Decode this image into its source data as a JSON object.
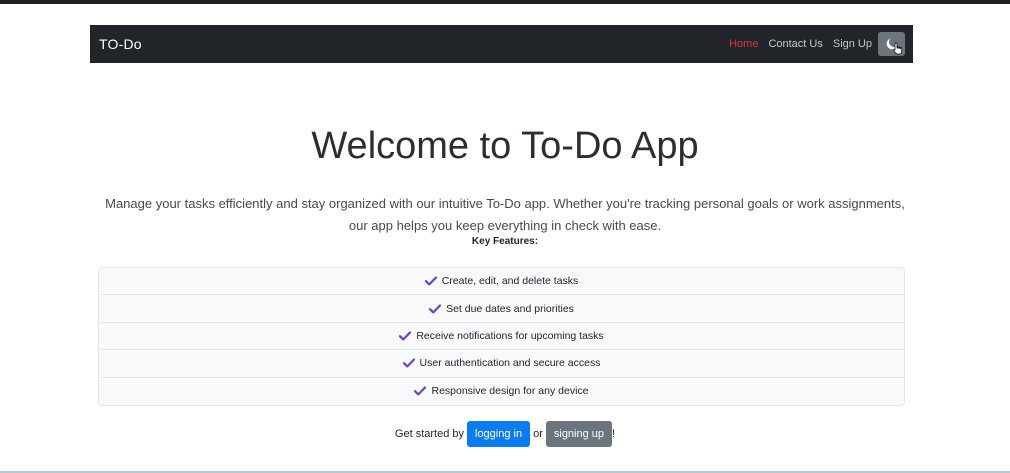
{
  "navbar": {
    "brand": "TO-Do",
    "links": [
      {
        "label": "Home",
        "active": true
      },
      {
        "label": "Contact Us",
        "active": false
      },
      {
        "label": "Sign Up",
        "active": false
      }
    ],
    "theme_toggle_icon": "moon-icon"
  },
  "hero": {
    "title": "Welcome to To-Do App",
    "lead": "Manage your tasks efficiently and stay organized with our intuitive To-Do app. Whether you're tracking personal goals or work assignments, our app helps you keep everything in check with ease."
  },
  "features": {
    "heading": "Key Features:",
    "icon": "check-icon",
    "items": [
      "Create, edit, and delete tasks",
      "Set due dates and priorities",
      "Receive notifications for upcoming tasks",
      "User authentication and secure access",
      "Responsive design for any device"
    ]
  },
  "cta": {
    "prefix": "Get started by",
    "login_label": "logging in",
    "middle": "or",
    "signup_label": "signing up",
    "suffix": "!"
  },
  "colors": {
    "navbar_bg": "#212529",
    "active_link": "#e0353d",
    "primary": "#0a7cf0",
    "secondary": "#6c757d",
    "check": "#6f42c1"
  }
}
